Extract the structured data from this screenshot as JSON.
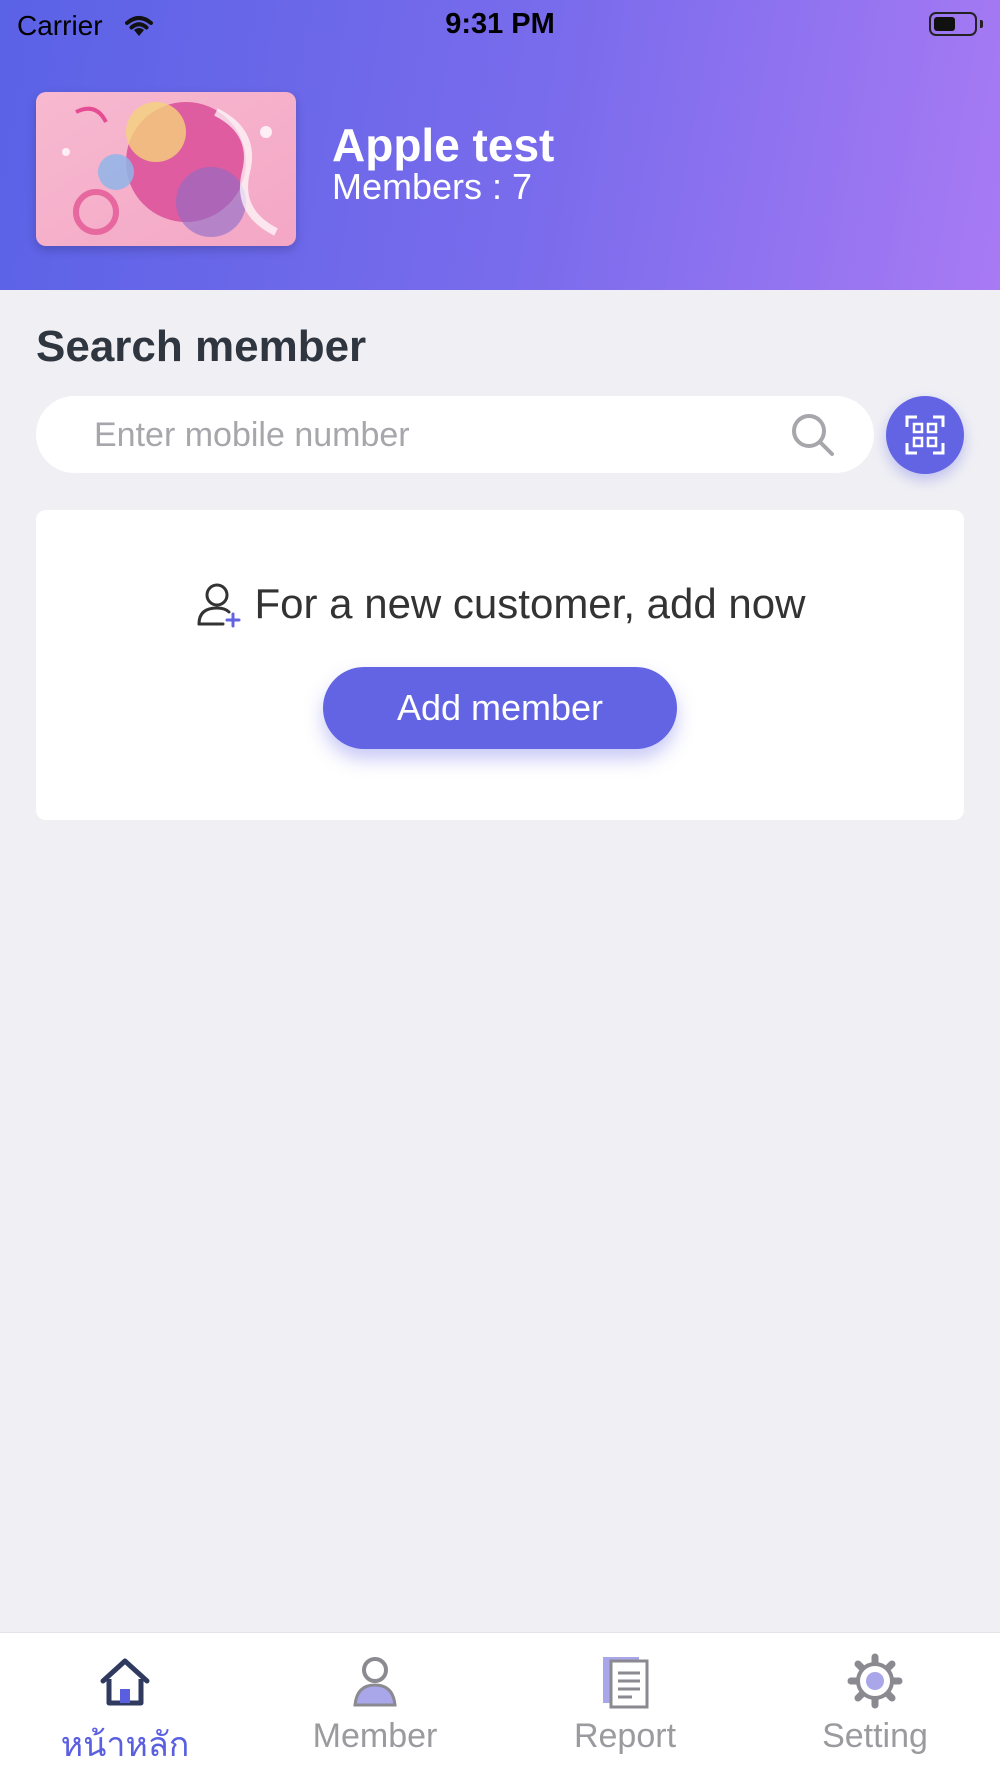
{
  "status_bar": {
    "carrier": "Carrier",
    "time": "9:31 PM"
  },
  "header": {
    "store_name": "Apple test",
    "members_text": "Members : 7"
  },
  "search": {
    "title": "Search member",
    "placeholder": "Enter mobile number"
  },
  "new_customer": {
    "prompt": "For a new customer, add now",
    "button": "Add member"
  },
  "tabs": [
    {
      "label": "หน้าหลัก",
      "icon": "home-icon",
      "active": true
    },
    {
      "label": "Member",
      "icon": "member-icon",
      "active": false
    },
    {
      "label": "Report",
      "icon": "report-icon",
      "active": false
    },
    {
      "label": "Setting",
      "icon": "gear-icon",
      "active": false
    }
  ],
  "colors": {
    "accent": "#6264e4",
    "header_start": "#5a62e6",
    "header_end": "#a87af4",
    "background": "#f0f0f4"
  }
}
